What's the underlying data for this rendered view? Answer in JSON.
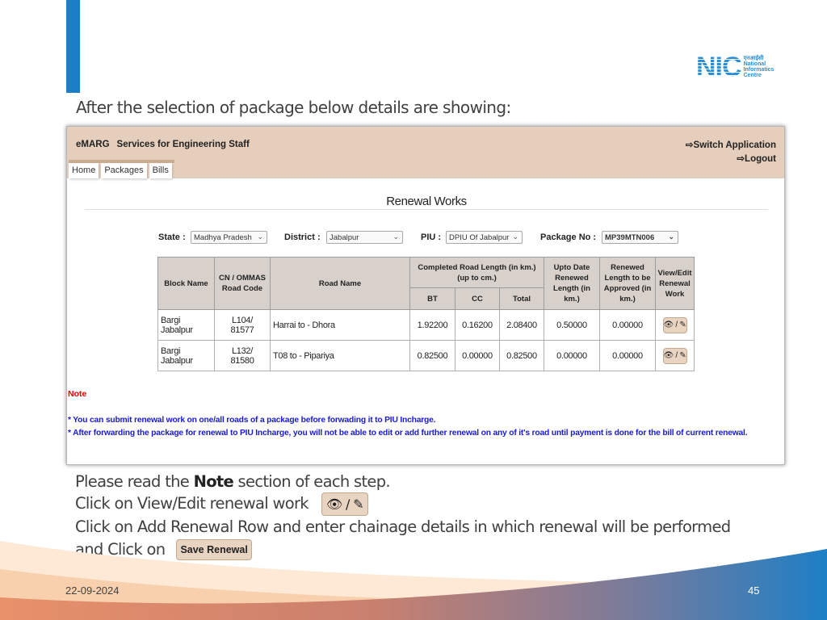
{
  "slide": {
    "title": "After the selection of package below details are showing:",
    "logo": {
      "mark": "NIC",
      "hindi": "एनआईसी",
      "line1": "National",
      "line2": "Informatics",
      "line3": "Centre"
    },
    "footer": {
      "date": "22-09-2024",
      "page_number": "45"
    },
    "colors": {
      "accent": "#1a7ec8",
      "header_bg": "#e5cebb",
      "note_title": "#e60000",
      "note_text": "#1a1ad4"
    }
  },
  "app": {
    "brand": "eMARG",
    "subtitle": "Services for Engineering Staff",
    "switch_application": "Switch Application",
    "logout": "Logout",
    "switch_icon": "sign-out-icon",
    "nav": [
      {
        "label": "Home"
      },
      {
        "label": "Packages"
      },
      {
        "label": "Bills"
      }
    ],
    "page_heading": "Renewal Works",
    "filters": {
      "state_label": "State :",
      "state_value": "Madhya Pradesh",
      "district_label": "District :",
      "district_value": "Jabalpur",
      "piu_label": "PIU :",
      "piu_value": "DPIU Of Jabalpur",
      "package_label": "Package No :",
      "package_value": "MP39MTN006"
    },
    "table": {
      "headers": {
        "block_name": "Block Name",
        "road_code": "CN / OMMAS Road Code",
        "road_name": "Road Name",
        "completed_length": "Completed Road Length (in km.) (up to cm.)",
        "bt": "BT",
        "cc": "CC",
        "total": "Total",
        "upto_date_renewed": "Upto Date Renewed Length (in km.)",
        "renewed_to_approve": "Renewed Length to be Approved (in km.)",
        "view_edit": "View/Edit Renewal Work"
      },
      "rows": [
        {
          "block": "Bargi Jabalpur",
          "code_line1": "L104/",
          "code_line2": "81577",
          "road": "Harrai to - Dhora",
          "bt": "1.92200",
          "cc": "0.16200",
          "total": "2.08400",
          "renewed": "0.50000",
          "to_approve": "0.00000",
          "action": "👁 / ✎"
        },
        {
          "block": "Bargi Jabalpur",
          "code_line1": "L132/",
          "code_line2": "81580",
          "road": "T08 to - Pipariya",
          "bt": "0.82500",
          "cc": "0.00000",
          "total": "0.82500",
          "renewed": "0.00000",
          "to_approve": "0.00000",
          "action": "👁 / ✎"
        }
      ]
    },
    "note": {
      "title": "Note",
      "line1": "* You can submit renewal work on one/all roads of a package before forwading it to PIU Incharge.",
      "line2": "* After forwarding the package for renewal to PIU Incharge, you will not be able to edit or add further renewal on any of it's road until payment is done for the bill of current renewal."
    }
  },
  "instructions": {
    "line1_pre": "Please read the ",
    "line1_bold": "Note",
    "line1_post": " section of each step.",
    "line2": "Click on View/Edit renewal work",
    "line2_button": "👁 / ✎",
    "line3": "Click on Add Renewal Row and enter chainage details in which renewal will be performed",
    "line4": "and Click on",
    "save_button": "Save Renewal"
  }
}
